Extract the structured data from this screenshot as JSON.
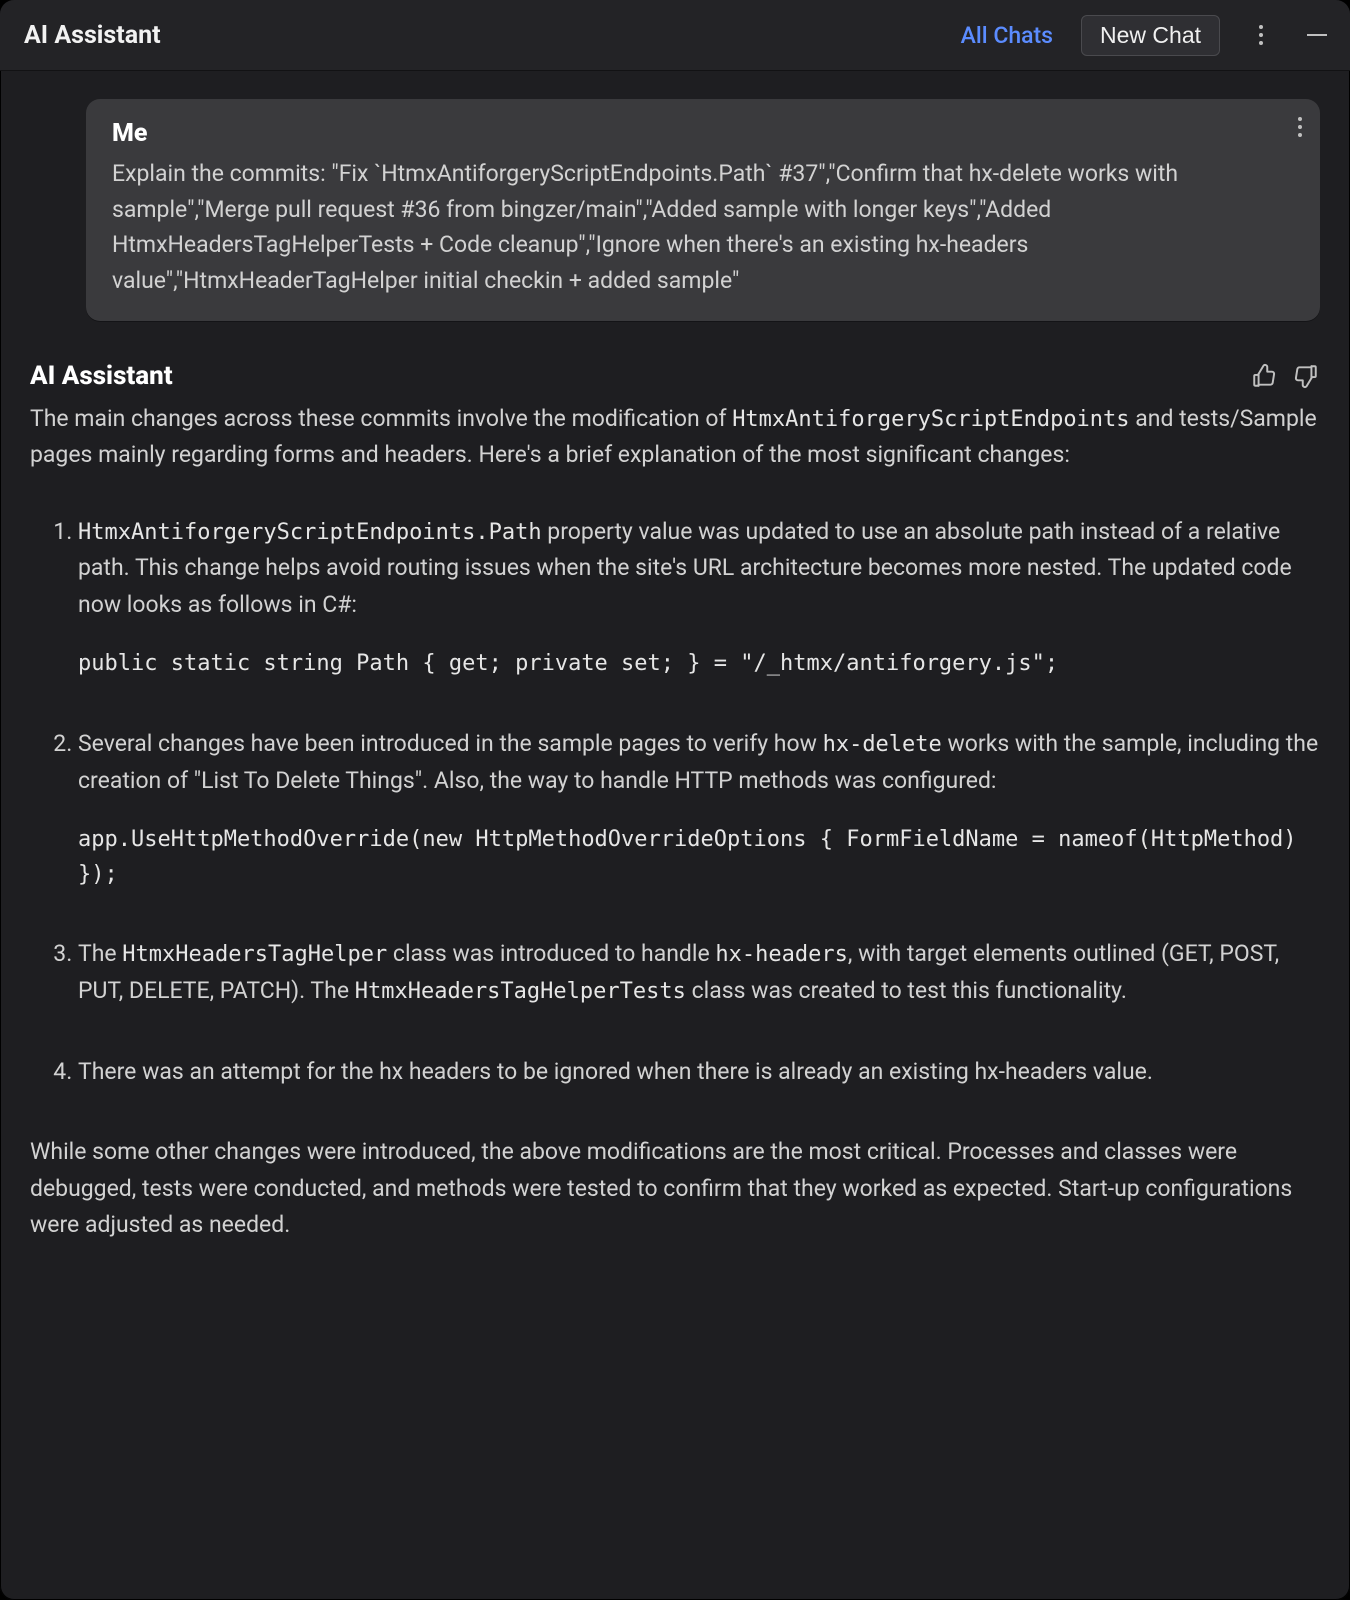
{
  "header": {
    "title": "AI Assistant",
    "all_chats": "All Chats",
    "new_chat": "New Chat"
  },
  "me_bubble": {
    "sender": "Me",
    "message": "Explain the commits: \"Fix `HtmxAntiforgeryScriptEndpoints.Path` #37\",\"Confirm that hx-delete works with sample\",\"Merge pull request #36 from bingzer/main\",\"Added sample with longer keys\",\"Added HtmxHeadersTagHelperTests + Code cleanup\",\"Ignore when there's an existing hx-headers value\",\"HtmxHeaderTagHelper initial checkin + added sample\""
  },
  "assistant": {
    "name": "AI Assistant",
    "intro_pre": "The main changes across these commits involve the modification of ",
    "intro_code": "HtmxAntiforgeryScriptEndpoints",
    "intro_post": " and tests/Sample pages mainly regarding forms and headers. Here's a brief explanation of the most significant changes:",
    "items": [
      {
        "text_pre_code": "HtmxAntiforgeryScriptEndpoints.Path",
        "text_after": " property value was updated to use an absolute path instead of a relative path. This change helps avoid routing issues when the site's URL architecture becomes more nested. The updated code now looks as follows in C#:",
        "code": "public static string Path { get; private set; } = \"/_htmx/antiforgery.js\";"
      },
      {
        "text_before": "Several changes have been introduced in the sample pages to verify how ",
        "inline_code": "hx-delete",
        "text_after": " works with the sample, including the creation of \"List To Delete Things\". Also, the way to handle HTTP methods was configured:",
        "code": "app.UseHttpMethodOverride(new HttpMethodOverrideOptions { FormFieldName = nameof(HttpMethod) });"
      },
      {
        "seg1": "The ",
        "code1": "HtmxHeadersTagHelper",
        "seg2": " class was introduced to handle ",
        "code2": "hx-headers",
        "seg3": ", with target elements outlined (GET, POST, PUT, DELETE, PATCH). The ",
        "code3": "HtmxHeadersTagHelperTests",
        "seg4": " class was created to test this functionality."
      },
      {
        "text": "There was an attempt for the hx headers to be ignored when there is already an existing hx-headers value."
      }
    ],
    "outro": "While some other changes were introduced, the above modifications are the most critical. Processes and classes were debugged, tests were conducted, and methods were tested to confirm that they worked as expected. Start-up configurations were adjusted as needed."
  }
}
